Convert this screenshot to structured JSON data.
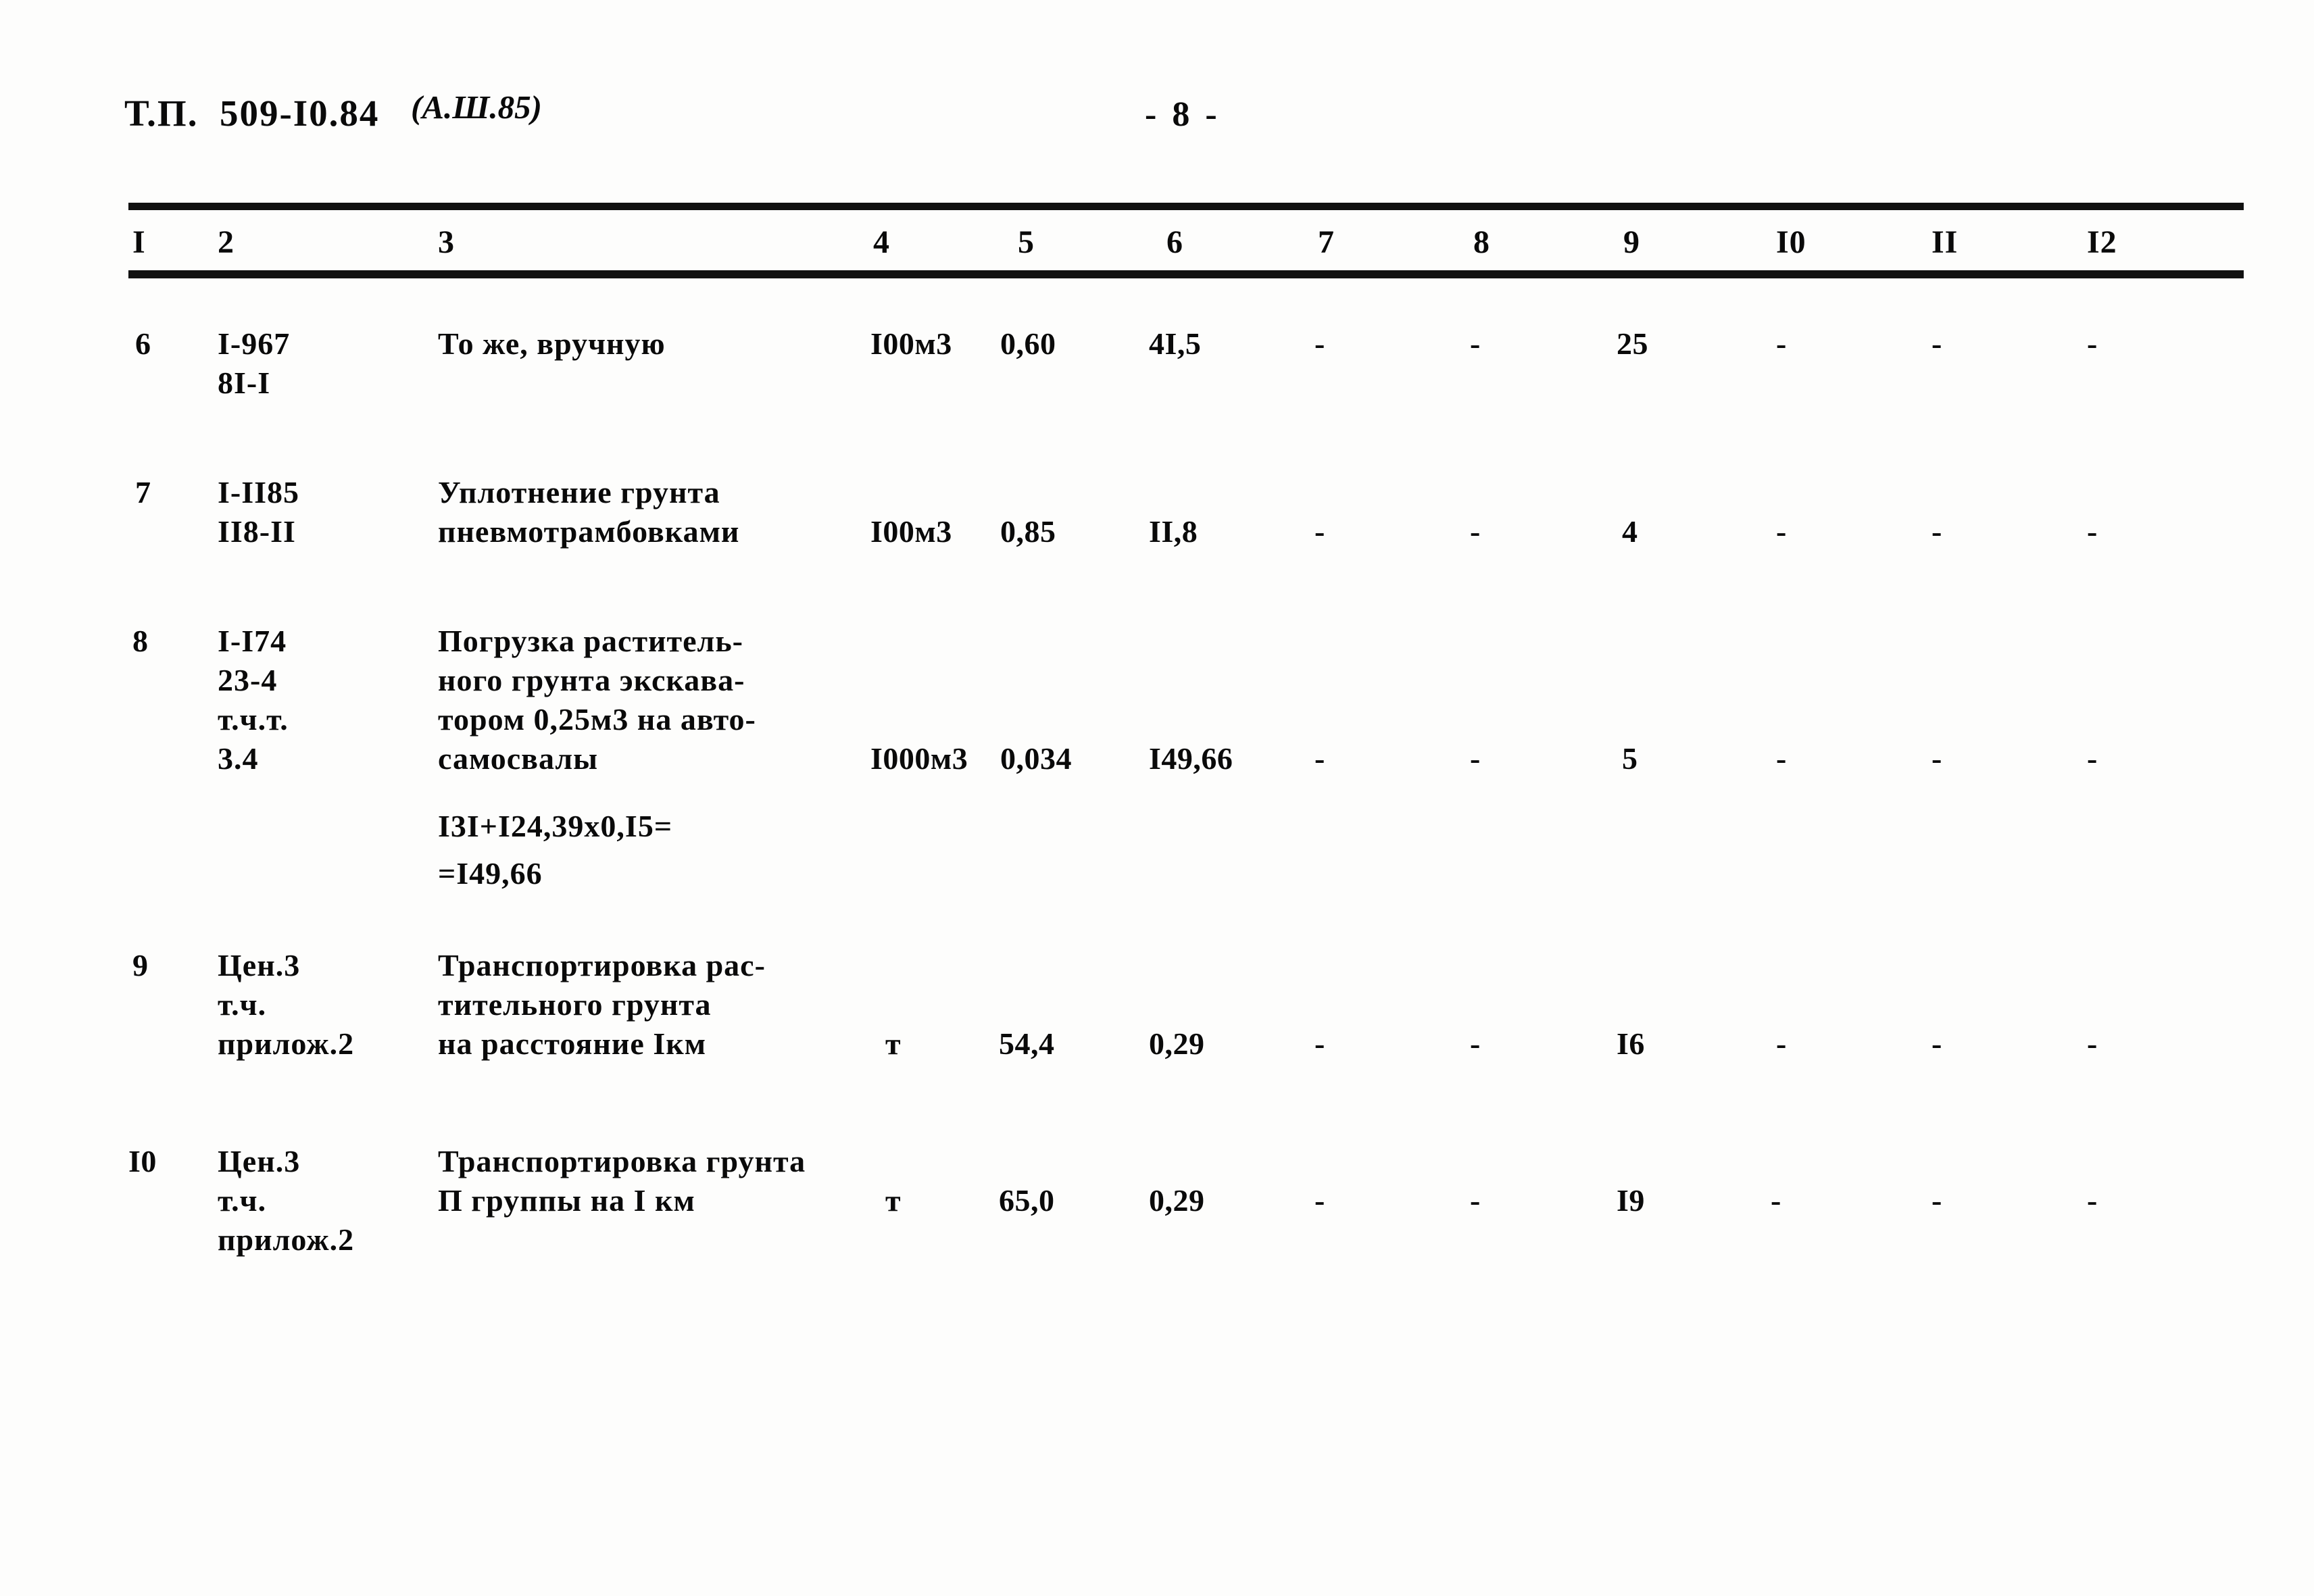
{
  "document": {
    "code": "Т.П.  509-I0.84",
    "revision": "(А.Ш.85)",
    "page_marker": "- 8 -"
  },
  "table": {
    "column_headers": [
      "I",
      "2",
      "3",
      "4",
      "5",
      "6",
      "7",
      "8",
      "9",
      "I0",
      "II",
      "I2"
    ],
    "rows": [
      {
        "c1": "6",
        "c2": [
          "I-967",
          "8I-I"
        ],
        "c3": [
          "То же, вручную"
        ],
        "c4": "I00м3",
        "c5": "0,60",
        "c6": "4I,5",
        "c7": "-",
        "c8": "-",
        "c9": "25",
        "c10": "-",
        "c11": "-",
        "c12": "-"
      },
      {
        "c1": "7",
        "c2": [
          "I-II85",
          "II8-II"
        ],
        "c3": [
          "Уплотнение грунта",
          "пневмотрамбовками"
        ],
        "c4": "I00м3",
        "c5": "0,85",
        "c6": "II,8",
        "c7": "-",
        "c8": "-",
        "c9": "4",
        "c10": "-",
        "c11": "-",
        "c12": "-"
      },
      {
        "c1": "8",
        "c2": [
          "I-I74",
          "23-4",
          "т.ч.т.",
          "3.4"
        ],
        "c3": [
          "Погрузка раститель-",
          "ного грунта экскава-",
          "тором 0,25м3 на авто-",
          "самосвалы"
        ],
        "c3_calc": [
          "I3I+I24,39х0,I5=",
          "=I49,66"
        ],
        "c4": "I000м3",
        "c5": "0,034",
        "c6": "I49,66",
        "c7": "-",
        "c8": "-",
        "c9": "5",
        "c10": "-",
        "c11": "-",
        "c12": "-"
      },
      {
        "c1": "9",
        "c2": [
          "Цен.3",
          "т.ч.",
          "прилож.2"
        ],
        "c3": [
          "Транспортировка рас-",
          "тительного грунта",
          "на расстояние Iкм"
        ],
        "c4": "т",
        "c5": "54,4",
        "c6": "0,29",
        "c7": "-",
        "c8": "-",
        "c9": "I6",
        "c10": "-",
        "c11": "-",
        "c12": "-"
      },
      {
        "c1": "I0",
        "c2": [
          "Цен.3",
          "т.ч.",
          "прилож.2"
        ],
        "c3": [
          "Транспортировка грунта",
          "П группы на I км"
        ],
        "c4": "т",
        "c5": "65,0",
        "c6": "0,29",
        "c7": "-",
        "c8": "-",
        "c9": "I9",
        "c10": "-",
        "c11": "-",
        "c12": "-"
      }
    ]
  }
}
